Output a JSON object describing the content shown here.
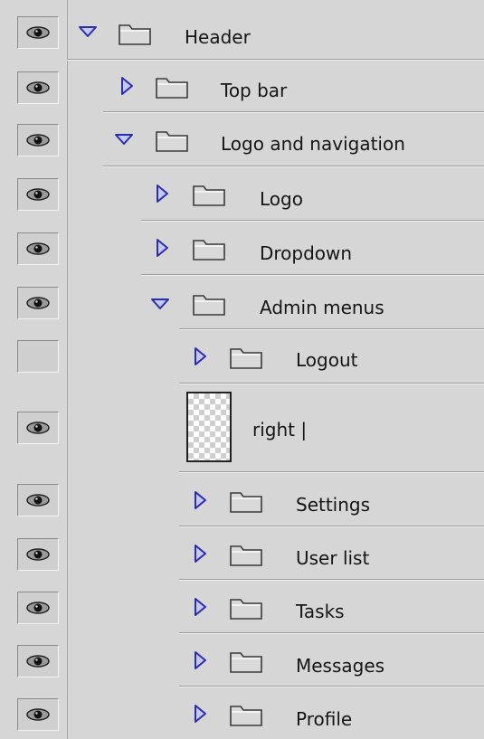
{
  "layers": [
    {
      "label": "Header",
      "visible": true,
      "type": "group",
      "expanded": true
    },
    {
      "label": "Top bar",
      "visible": true,
      "type": "group",
      "expanded": false
    },
    {
      "label": "Logo and navigation",
      "visible": true,
      "type": "group",
      "expanded": true
    },
    {
      "label": "Logo",
      "visible": true,
      "type": "group",
      "expanded": false
    },
    {
      "label": "Dropdown",
      "visible": true,
      "type": "group",
      "expanded": false
    },
    {
      "label": "Admin menus",
      "visible": true,
      "type": "group",
      "expanded": true
    },
    {
      "label": "Logout",
      "visible": false,
      "type": "group",
      "expanded": false
    },
    {
      "label": "right |",
      "visible": true,
      "type": "layer"
    },
    {
      "label": "Settings",
      "visible": true,
      "type": "group",
      "expanded": false
    },
    {
      "label": "User list",
      "visible": true,
      "type": "group",
      "expanded": false
    },
    {
      "label": "Tasks",
      "visible": true,
      "type": "group",
      "expanded": false
    },
    {
      "label": "Messages",
      "visible": true,
      "type": "group",
      "expanded": false
    },
    {
      "label": "Profile",
      "visible": true,
      "type": "group",
      "expanded": false
    }
  ],
  "colors": {
    "panel_bg": "#d6d6d6",
    "triangle_fill": "#c4c8f4",
    "triangle_stroke": "#2b2ea8",
    "folder_fill": "#d9d9d9"
  },
  "icons": {
    "visibility": "eye-icon",
    "expanded": "triangle-down-icon",
    "collapsed": "triangle-right-icon",
    "group": "folder-icon",
    "layer_thumbnail": "transparent-thumbnail-icon"
  }
}
